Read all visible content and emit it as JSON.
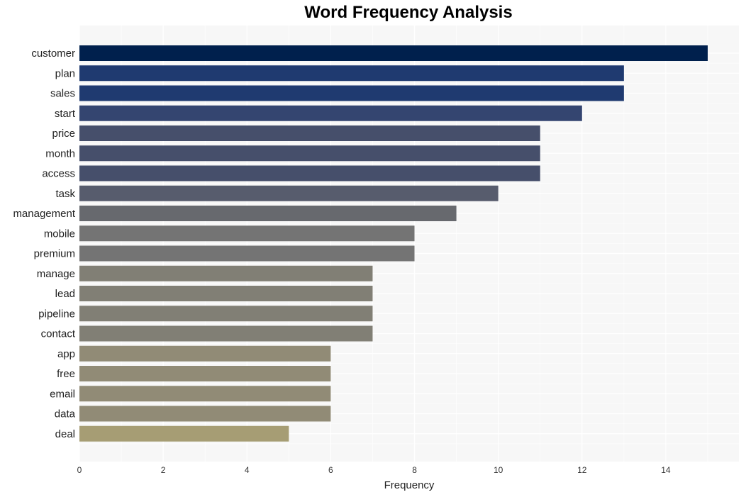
{
  "chart_data": {
    "type": "bar",
    "orientation": "horizontal",
    "title": "Word Frequency Analysis",
    "xlabel": "Frequency",
    "ylabel": "",
    "xlim": [
      0,
      15.5
    ],
    "x_ticks": [
      0,
      2,
      4,
      6,
      8,
      10,
      12,
      14
    ],
    "grid": true,
    "legend": "none",
    "categories": [
      "customer",
      "plan",
      "sales",
      "start",
      "price",
      "month",
      "access",
      "task",
      "management",
      "mobile",
      "premium",
      "manage",
      "lead",
      "pipeline",
      "contact",
      "app",
      "free",
      "email",
      "data",
      "deal"
    ],
    "values": [
      15,
      13,
      13,
      12,
      11,
      11,
      11,
      10,
      9,
      8,
      8,
      7,
      7,
      7,
      7,
      6,
      6,
      6,
      6,
      5
    ],
    "colors": [
      "#00204d",
      "#1f3a70",
      "#1f3a70",
      "#344570",
      "#464f6b",
      "#464f6b",
      "#464f6b",
      "#575c6d",
      "#67696e",
      "#747474",
      "#747474",
      "#817f75",
      "#817f75",
      "#817f75",
      "#817f75",
      "#918b76",
      "#918b76",
      "#918b76",
      "#918b76",
      "#a69d74"
    ]
  }
}
